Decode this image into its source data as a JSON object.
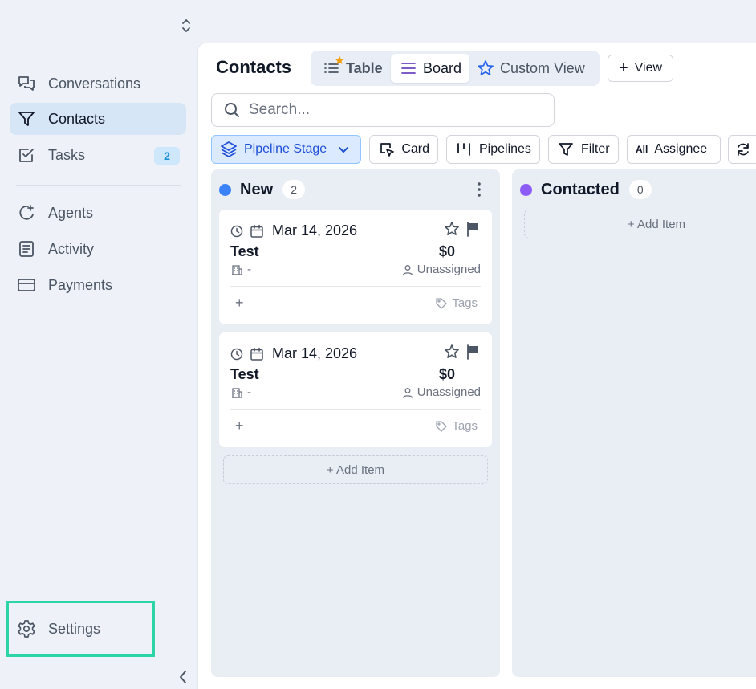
{
  "sidebar": {
    "items": [
      {
        "label": "Conversations"
      },
      {
        "label": "Contacts"
      },
      {
        "label": "Tasks",
        "badge": "2"
      },
      {
        "label": "Agents"
      },
      {
        "label": "Activity"
      },
      {
        "label": "Payments"
      }
    ],
    "settings_label": "Settings"
  },
  "header": {
    "title": "Contacts",
    "tabs": [
      {
        "label": "Table"
      },
      {
        "label": "Board",
        "active": true
      },
      {
        "label": "Custom View"
      }
    ],
    "add_view_label": "View"
  },
  "search": {
    "placeholder": "Search..."
  },
  "toolbar": {
    "pipeline_stage": "Pipeline Stage",
    "card": "Card",
    "pipelines": "Pipelines",
    "filter": "Filter",
    "all_tag": "All",
    "assignee": "Assignee"
  },
  "board": {
    "columns": [
      {
        "title": "New",
        "count": "2",
        "dot_color": "#3b82f6",
        "cards": [
          {
            "date": "Mar 14, 2026",
            "name": "Test",
            "value": "$0",
            "company": "-",
            "assignee": "Unassigned",
            "tags": "Tags",
            "plus": "+"
          },
          {
            "date": "Mar 14, 2026",
            "name": "Test",
            "value": "$0",
            "company": "-",
            "assignee": "Unassigned",
            "tags": "Tags",
            "plus": "+"
          }
        ],
        "add_label": "+ Add Item"
      },
      {
        "title": "Contacted",
        "count": "0",
        "dot_color": "#8b5cf6",
        "cards": [],
        "add_label": "+ Add Item"
      }
    ]
  },
  "colors": {
    "accent": "#1d4ed8",
    "highlight": "#2dd4a7",
    "active_nav": "#d6e6f7",
    "star": "#f59e0b"
  }
}
